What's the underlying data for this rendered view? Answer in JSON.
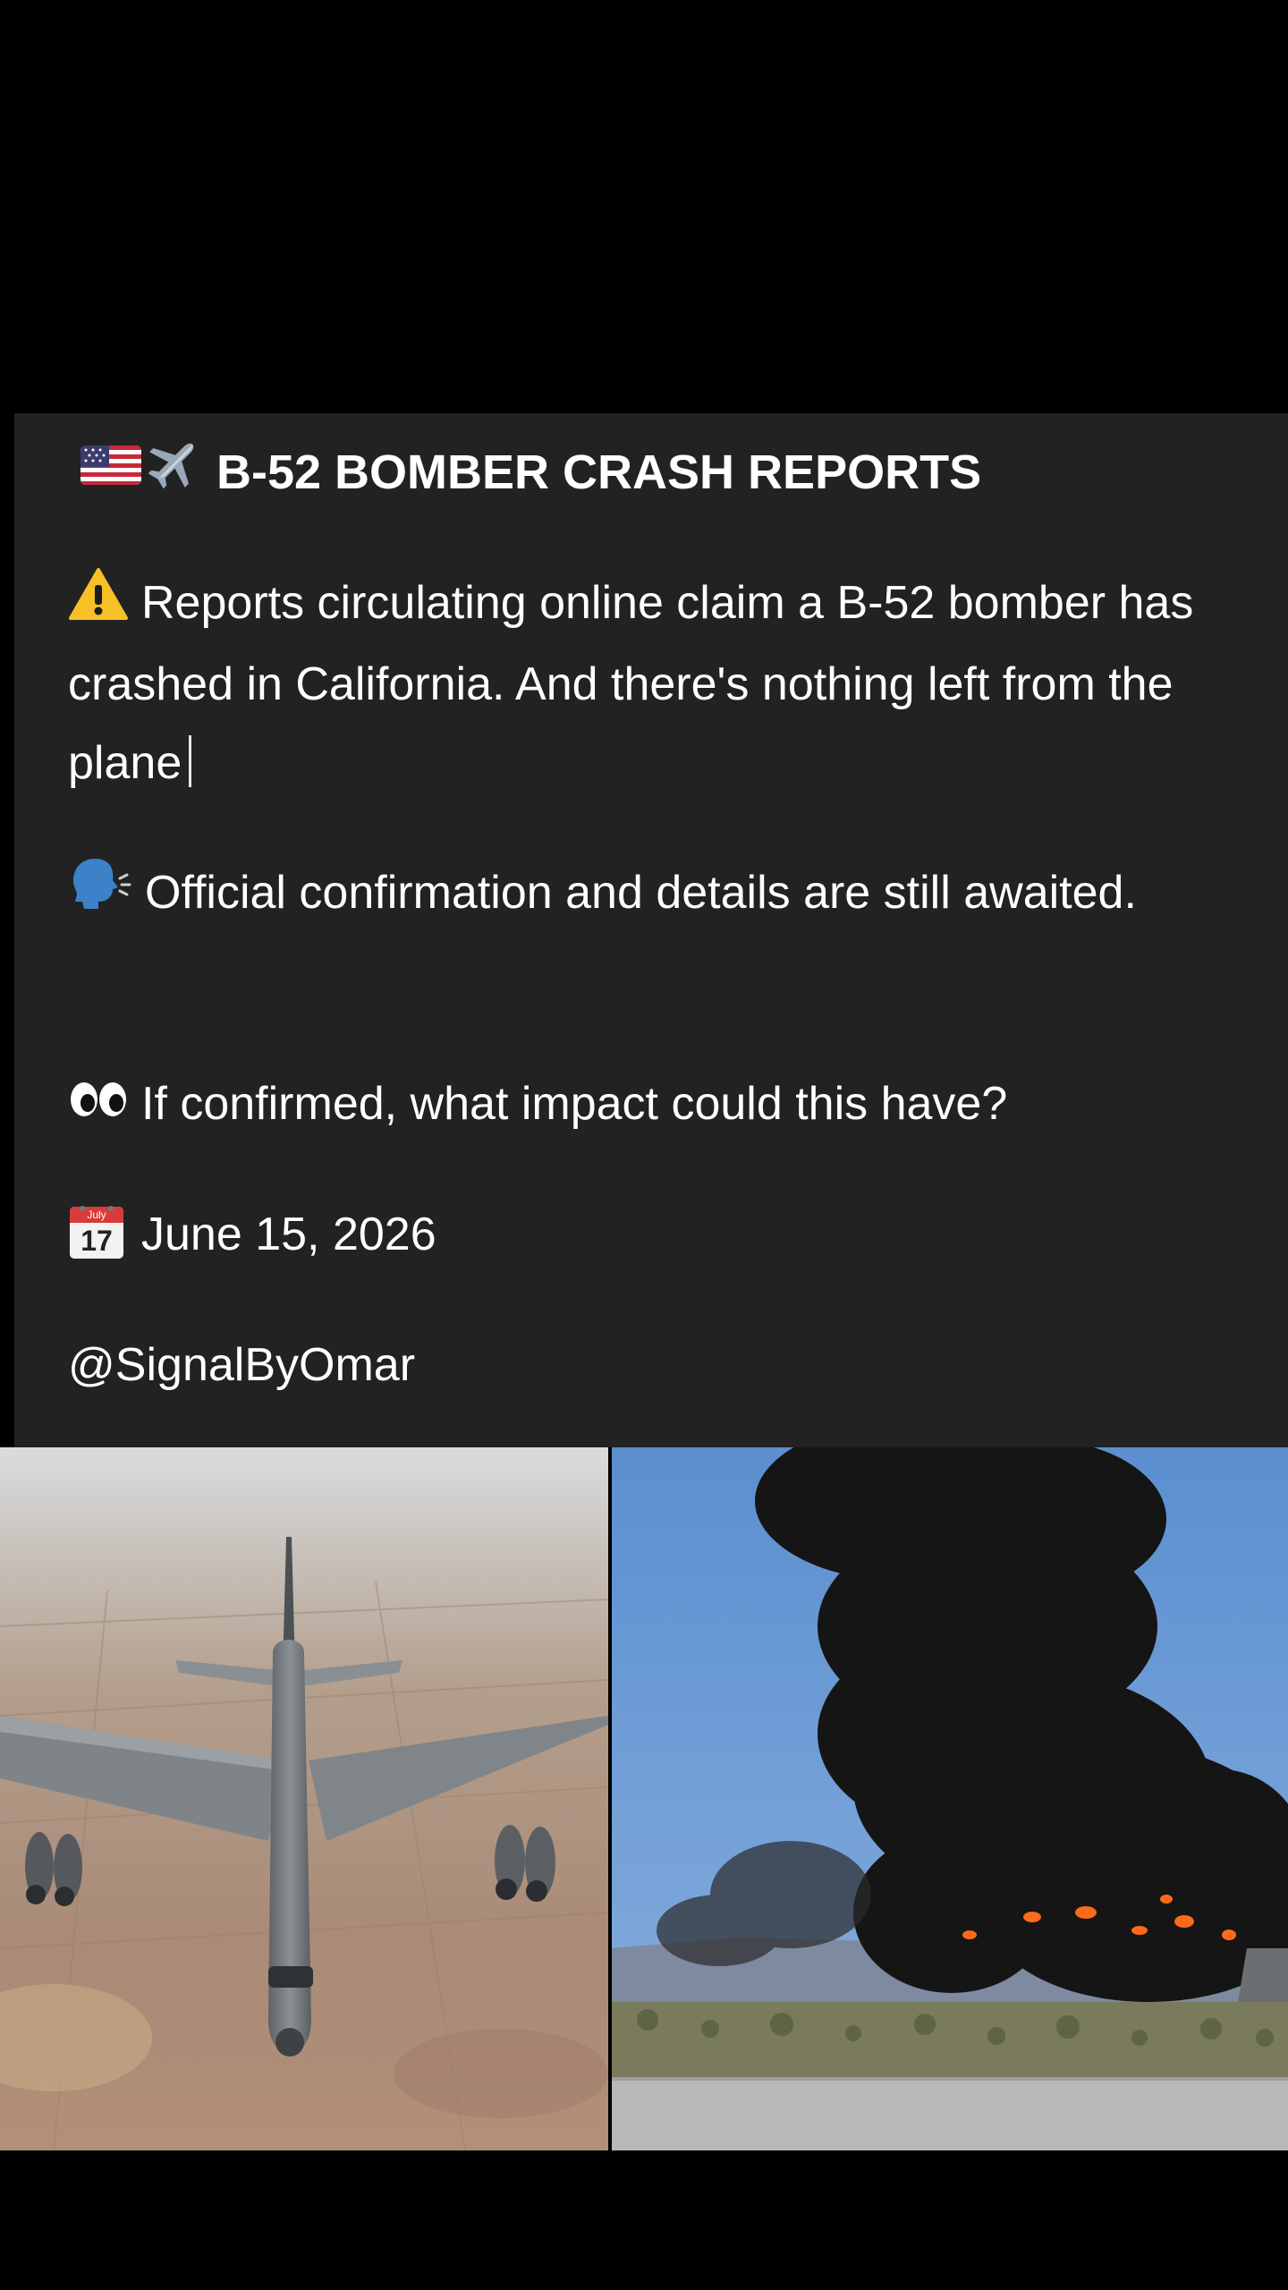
{
  "post": {
    "headline": "B-52 BOMBER CRASH REPORTS",
    "headline_icons": [
      "us-flag-icon",
      "airplane-icon"
    ],
    "paragraphs": [
      {
        "icon": "warning-icon",
        "text": "Reports circulating online claim a B-52 bomber has crashed in California. And there's nothing left from the plane"
      },
      {
        "icon": "speaking-head-icon",
        "text": "Official confirmation and details are still awaited."
      },
      {
        "icon": "eyes-icon",
        "text": "If confirmed, what impact could this have?"
      }
    ],
    "date_icon": "calendar-icon",
    "calendar_month": "July",
    "calendar_day": "17",
    "date": "June 15, 2026",
    "handle": "@SignalByOmar"
  },
  "images": [
    {
      "name": "b52-bomber-photo"
    },
    {
      "name": "smoke-plume-photo"
    }
  ],
  "colors": {
    "page_background": "#000000",
    "card_background": "#222222",
    "text": "#ffffff",
    "warning": "#f6c026",
    "speaking_head": "#3b82c8",
    "calendar_red": "#d93a3a",
    "flag_red": "#c8283a",
    "flag_blue": "#3c3b6e"
  }
}
